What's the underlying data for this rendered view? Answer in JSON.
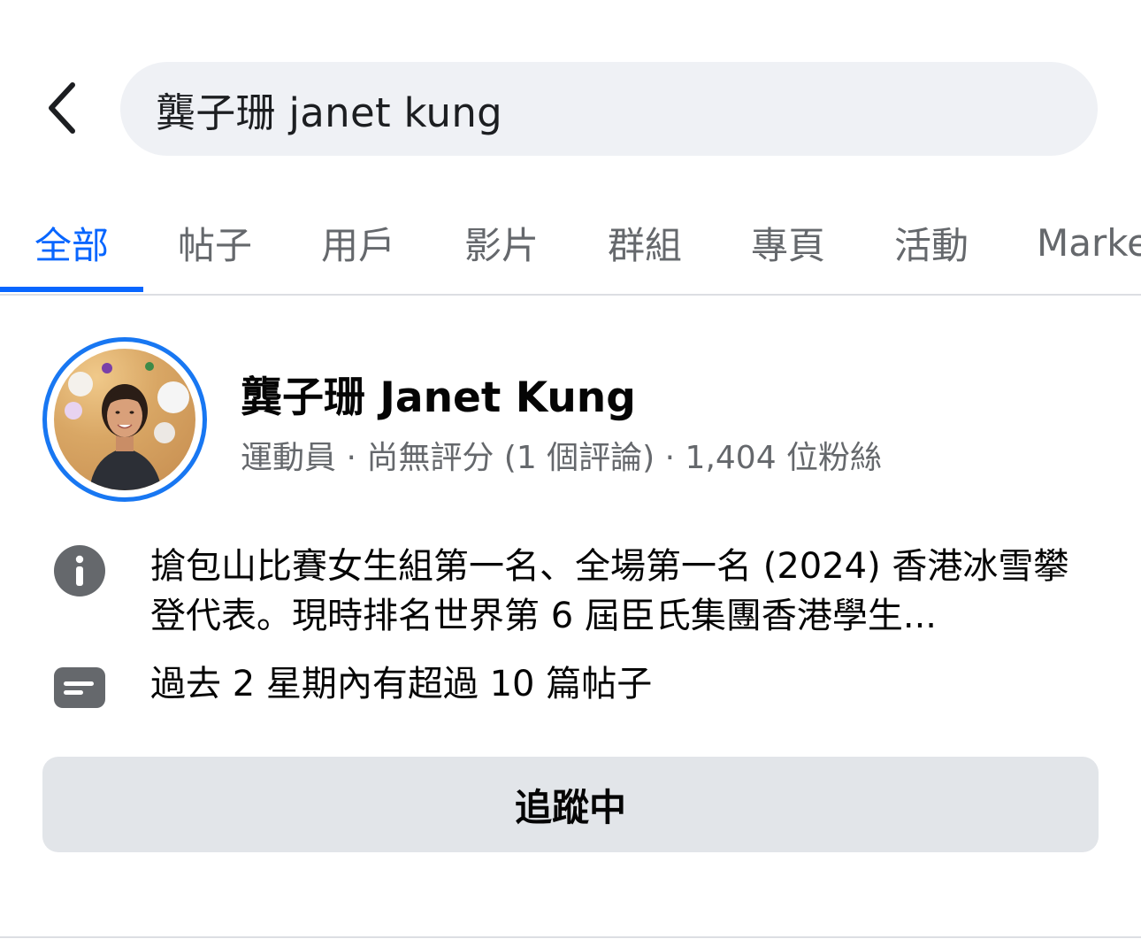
{
  "search": {
    "query": "龔子珊 janet kung"
  },
  "tabs": [
    {
      "label": "全部",
      "active": true
    },
    {
      "label": "帖子",
      "active": false
    },
    {
      "label": "用戶",
      "active": false
    },
    {
      "label": "影片",
      "active": false
    },
    {
      "label": "群組",
      "active": false
    },
    {
      "label": "專頁",
      "active": false
    },
    {
      "label": "活動",
      "active": false
    },
    {
      "label": "Marke",
      "active": false
    }
  ],
  "result": {
    "name": "龔子珊 Janet Kung",
    "meta": "運動員 · 尚無評分 (1 個評論) · 1,404 位粉絲",
    "about": "搶包山比賽女生組第一名、全場第一名 (2024) 香港冰雪攀登代表。現時排名世界第 6 屆臣氏集團香港學生...",
    "posts_activity": "過去 2 星期內有超過 10 篇帖子",
    "follow_label": "追蹤中"
  },
  "colors": {
    "accent": "#0866ff",
    "avatar_ring": "#1877f2",
    "muted_text": "#65686c",
    "search_bg": "#eff1f5",
    "button_bg": "#e2e5e9"
  },
  "icons": {
    "back": "chevron-left-icon",
    "info": "info-circle-icon",
    "posts": "posts-card-icon"
  }
}
